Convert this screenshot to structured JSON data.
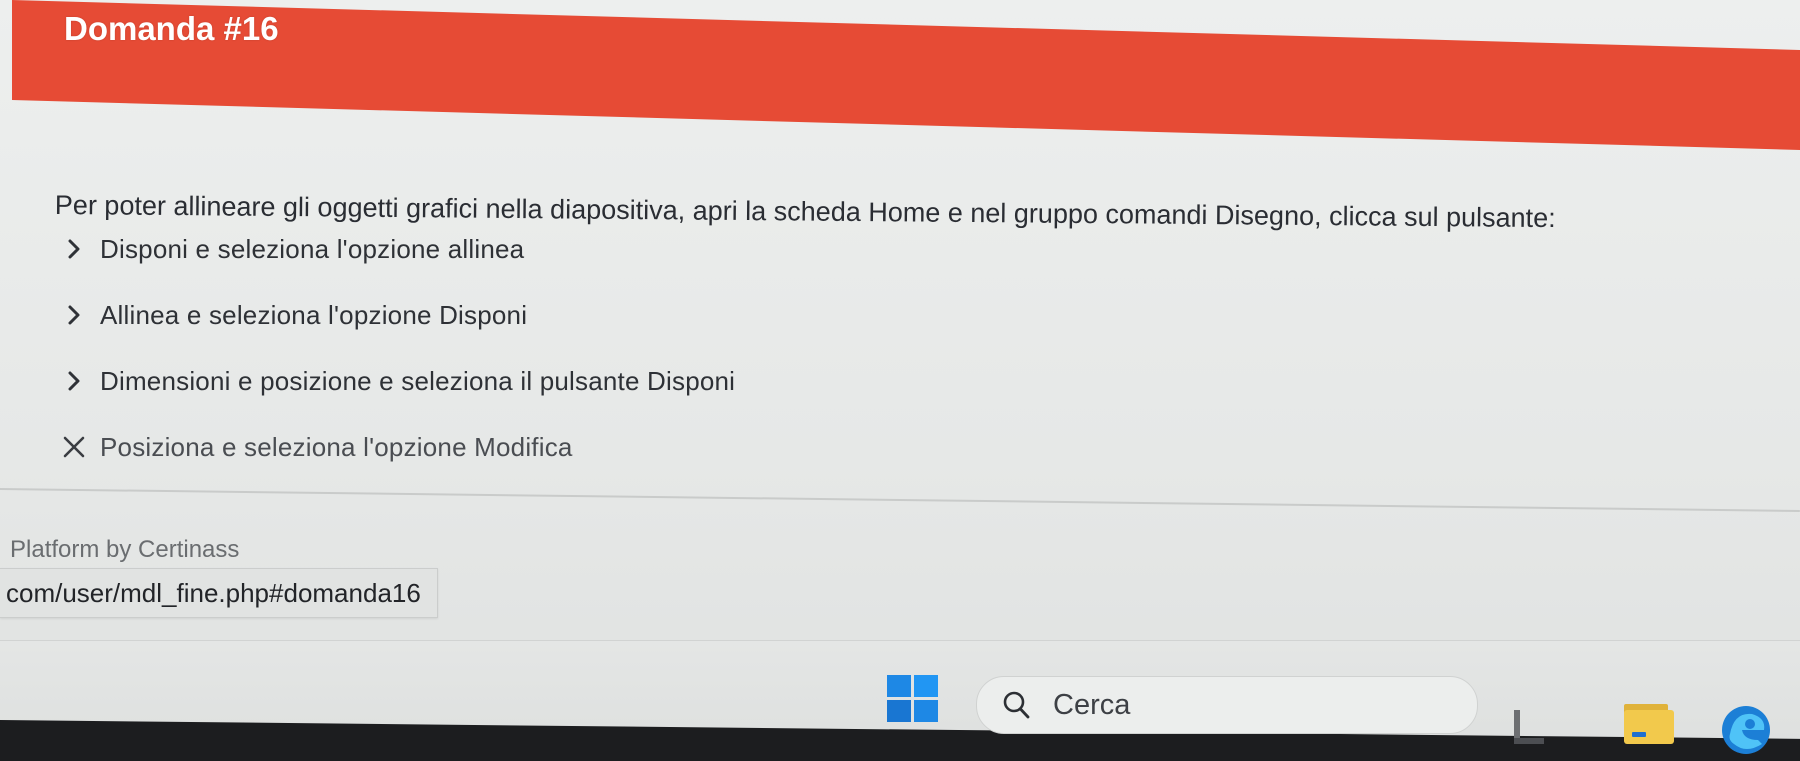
{
  "header": {
    "title": "Domanda #16",
    "color": "#e64b35"
  },
  "question": {
    "text": "Per poter allineare gli oggetti grafici nella diapositiva, apri la scheda Home e nel gruppo comandi Disegno, clicca sul pulsante:",
    "options": [
      {
        "label": "Disponi e seleziona l'opzione allinea",
        "icon": "chevron-right-icon",
        "state": "unanswered"
      },
      {
        "label": "Allinea e seleziona l'opzione Disponi",
        "icon": "chevron-right-icon",
        "state": "unanswered"
      },
      {
        "label": "Dimensioni e posizione e seleziona il pulsante Disponi",
        "icon": "chevron-right-icon",
        "state": "unanswered"
      },
      {
        "label": "Posiziona e seleziona l'opzione Modifica",
        "icon": "close-icon",
        "state": "wrong"
      }
    ]
  },
  "footer": {
    "platform_credit": "Platform by Certinass"
  },
  "status_bar": {
    "url": "com/user/mdl_fine.php#domanda16"
  },
  "taskbar": {
    "search_placeholder": "Cerca",
    "start_icon": "windows-start-icon",
    "apps": [
      "widgets-icon",
      "file-explorer-icon",
      "edge-browser-icon"
    ],
    "accent_color": "#1e88e5"
  }
}
